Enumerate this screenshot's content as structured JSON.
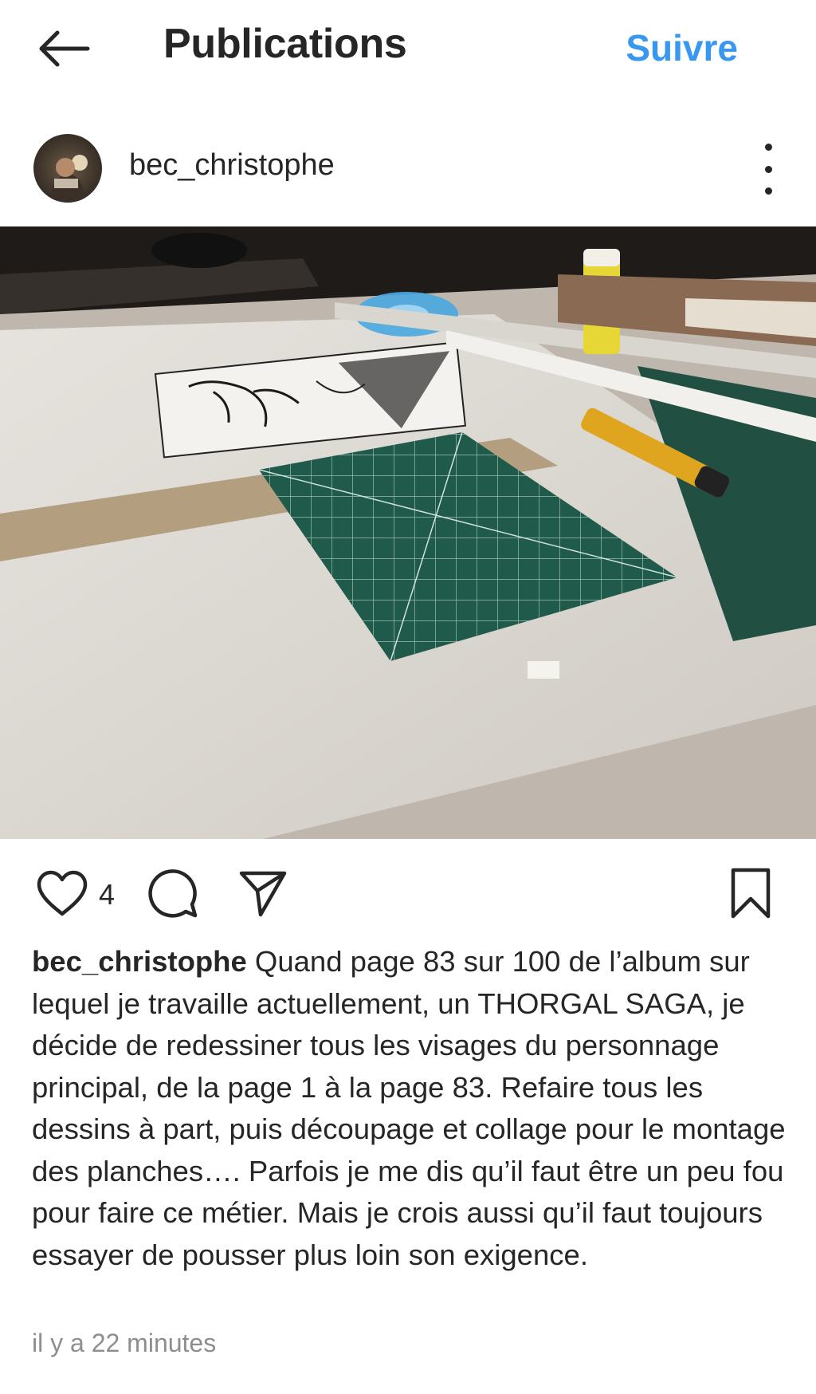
{
  "header": {
    "title": "Publications",
    "follow_label": "Suivre",
    "back_icon": "arrow-left-icon"
  },
  "post": {
    "username": "bec_christophe",
    "more_icon": "more-vertical-icon",
    "actions": {
      "like_icon": "heart-icon",
      "like_count": "4",
      "comment_icon": "comment-icon",
      "share_icon": "send-icon",
      "save_icon": "bookmark-icon"
    },
    "caption_user": "bec_christophe",
    "caption_text": " Quand page 83 sur 100 de l’album sur lequel je travaille actuellement, un THORGAL SAGA, je décide de redessiner tous les visages du personnage principal, de la page 1 à la page 83. Refaire tous les dessins à part, puis découpage et collage pour le montage des planches…. Parfois je me dis qu’il faut être un peu fou pour faire ce métier. Mais je crois aussi qu’il faut toujours essayer de pousser plus loin son exigence.",
    "timestamp": "il y a 22 minutes"
  },
  "colors": {
    "text": "#262626",
    "link": "#3897f0",
    "muted": "#8e8e8e"
  }
}
